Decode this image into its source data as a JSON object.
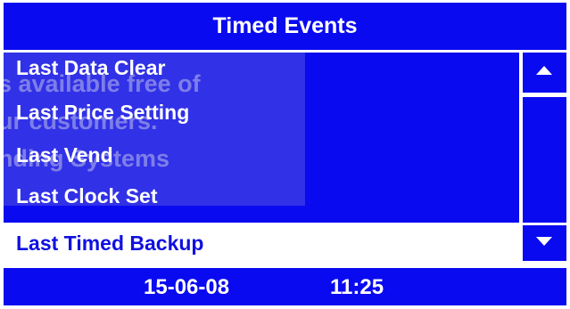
{
  "header": {
    "title": "Timed Events"
  },
  "watermark": {
    "lines": [
      "s available free of",
      "ur customers.",
      "nding Systems"
    ]
  },
  "menu": {
    "items": [
      {
        "label": "Last Data Clear",
        "selected": false
      },
      {
        "label": "Last Price Setting",
        "selected": false
      },
      {
        "label": "Last Vend",
        "selected": false
      },
      {
        "label": "Last Clock Set",
        "selected": false
      },
      {
        "label": "Last Timed Backup",
        "selected": true
      }
    ]
  },
  "scroll": {
    "up_icon": "triangle-up",
    "down_icon": "triangle-down"
  },
  "footer": {
    "date": "15-06-08",
    "time": "11:25"
  },
  "colors": {
    "primary_blue": "#0a0af0",
    "selected_text": "#1010e0",
    "background": "#ffffff"
  }
}
